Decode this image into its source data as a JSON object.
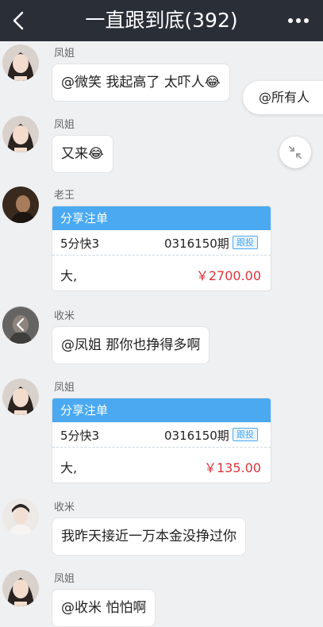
{
  "header": {
    "title": "一直跟到底(392)"
  },
  "messages": [
    {
      "sender": "凤姐",
      "text": "@微笑 我起高了 太吓人😂"
    },
    {
      "sender": "凤姐",
      "text": "又来😂"
    },
    {
      "sender": "老王",
      "card": {
        "header": "分享注单",
        "game": "5分快3",
        "issue": "0316150期",
        "follow": "跟投",
        "pick": "大,",
        "amount": "￥2700.00"
      }
    },
    {
      "sender": "收米",
      "text": "@凤姐 那你也挣得多啊"
    },
    {
      "sender": "凤姐",
      "card": {
        "header": "分享注单",
        "game": "5分快3",
        "issue": "0316150期",
        "follow": "跟投",
        "pick": "大,",
        "amount": "￥135.00"
      }
    },
    {
      "sender": "收米",
      "text": "我昨天接近一万本金没挣过你"
    },
    {
      "sender": "凤姐",
      "text": "@收米 怕怕啊"
    }
  ],
  "floating": {
    "at_all": "@所有人"
  },
  "colors": {
    "header_bg": "#2a2e37",
    "card_header": "#4aa9f0",
    "amount": "#d9363e",
    "background": "#eef0f2"
  }
}
